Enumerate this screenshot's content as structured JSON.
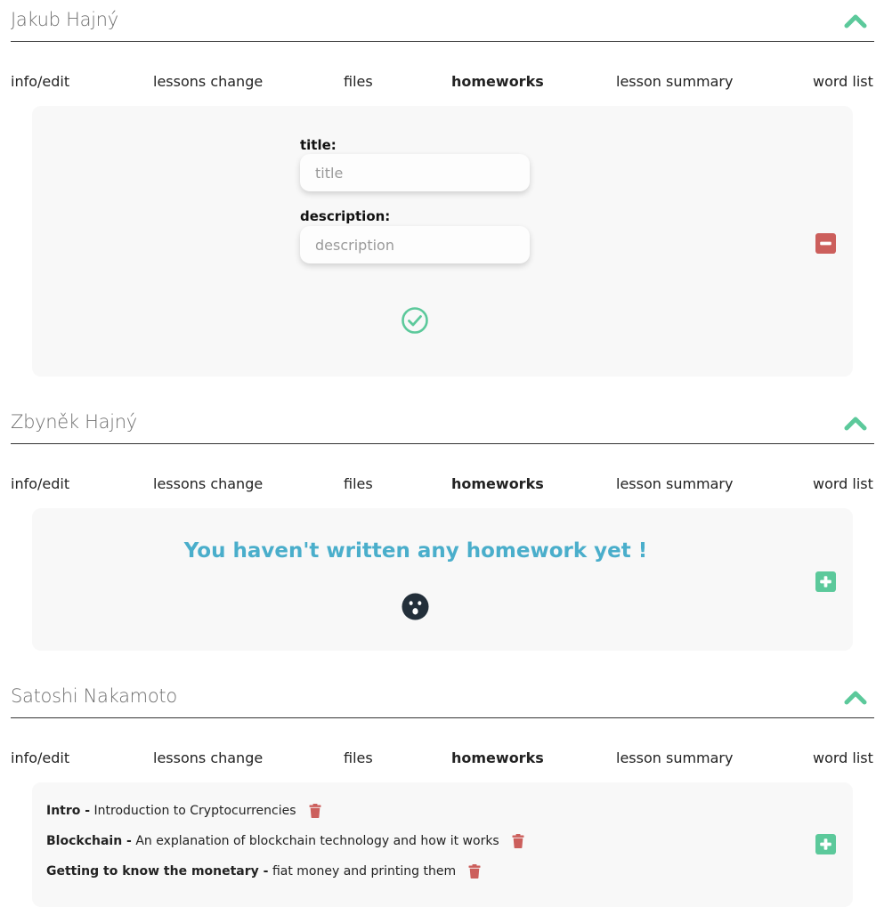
{
  "tabs": [
    "info/edit",
    "lessons change",
    "files",
    "homeworks",
    "lesson summary",
    "word list"
  ],
  "active_tab": "homeworks",
  "colors": {
    "accent_green": "#5cc99b",
    "danger_red": "#cc5f5c",
    "message_blue": "#4aaecb",
    "panel_bg": "#f8f8f8"
  },
  "students": [
    {
      "name": "Jakub Hajný",
      "form": {
        "title_label": "title:",
        "title_placeholder": "title",
        "description_label": "description:",
        "description_placeholder": "description"
      },
      "icons": [
        "chevron-up-icon",
        "check-circle-icon",
        "minus-square-icon"
      ]
    },
    {
      "name": "Zbyněk Hajný",
      "empty_message": "You haven't written any homework yet !",
      "icons": [
        "chevron-up-icon",
        "surprised-face-icon",
        "plus-square-icon"
      ]
    },
    {
      "name": "Satoshi Nakamoto",
      "homeworks": [
        {
          "title": "Intro -",
          "description": "Introduction to Cryptocurrencies"
        },
        {
          "title": "Blockchain -",
          "description": "An explanation of blockchain technology and how it works"
        },
        {
          "title": "Getting to know the monetary -",
          "description": "fiat money and printing them"
        }
      ],
      "icons": [
        "chevron-up-icon",
        "trash-icon",
        "plus-square-icon"
      ]
    }
  ]
}
